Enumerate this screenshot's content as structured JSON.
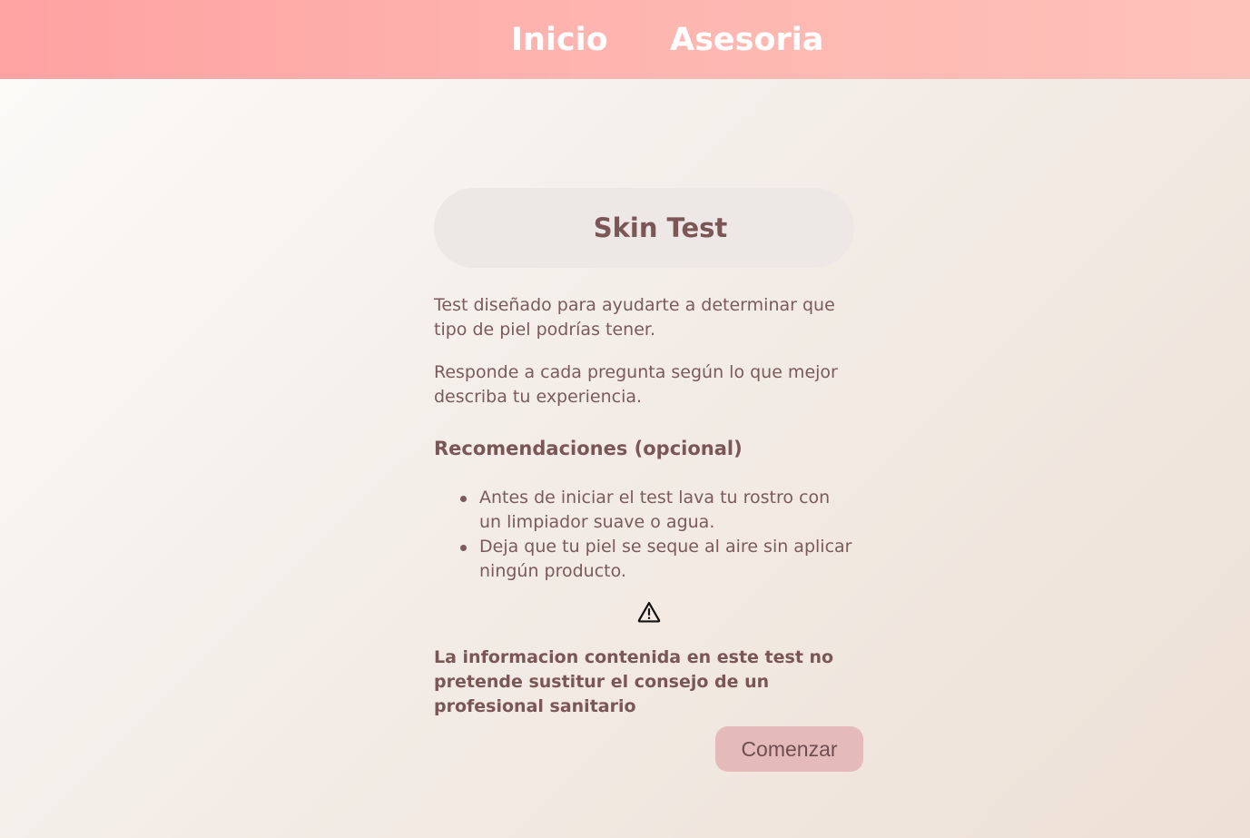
{
  "nav": {
    "items": [
      {
        "label": "Inicio"
      },
      {
        "label": "Asesoria"
      }
    ]
  },
  "main": {
    "title": "Skin Test",
    "intro": [
      "Test diseñado para ayudarte a determinar que tipo de piel podrías tener.",
      "Responde a cada pregunta según lo que mejor describa tu experiencia."
    ],
    "recommendations_heading": "Recomendaciones (opcional)",
    "recommendations": [
      "Antes de iniciar el test lava tu rostro con un limpiador suave o agua.",
      "Deja que tu piel se seque al aire sin aplicar ningún producto."
    ],
    "warning_icon": "warning-triangle-icon",
    "disclaimer": "La informacion contenida en este test no pretende sustitur el consejo de un profesional sanitario",
    "start_button": "Comenzar"
  },
  "colors": {
    "nav_gradient_start": "#fea2a2",
    "nav_gradient_end": "#fec2ba",
    "text": "#7a5a5a",
    "title_pill": "#ede7e6",
    "button": "#e5babb"
  }
}
